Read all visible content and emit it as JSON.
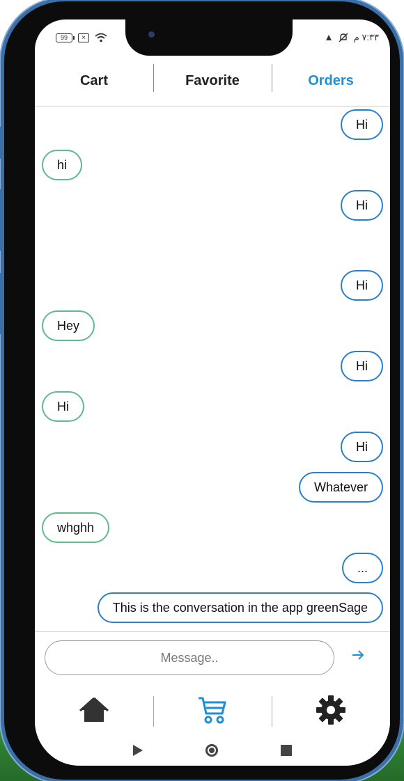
{
  "status_bar": {
    "battery": "99",
    "time": "٧:٣٣ م"
  },
  "tabs": [
    {
      "label": "Cart",
      "active": false
    },
    {
      "label": "Favorite",
      "active": false
    },
    {
      "label": "Orders",
      "active": true
    }
  ],
  "messages": [
    {
      "text": "Hi",
      "from": "me"
    },
    {
      "text": "hi",
      "from": "other"
    },
    {
      "text": "Hi",
      "from": "me"
    },
    {
      "text": "Hi",
      "from": "me"
    },
    {
      "text": "Hey",
      "from": "other"
    },
    {
      "text": "Hi",
      "from": "me"
    },
    {
      "text": "Hi",
      "from": "other"
    },
    {
      "text": "Hi",
      "from": "me"
    },
    {
      "text": "Whatever",
      "from": "me"
    },
    {
      "text": "whghh",
      "from": "other"
    },
    {
      "text": "...",
      "from": "me"
    },
    {
      "text": "This is the conversation in the app greenSage",
      "from": "me"
    }
  ],
  "composer": {
    "placeholder": "Message..",
    "send_icon": "arrow-right-icon"
  },
  "bottom_nav": [
    {
      "icon": "home-icon",
      "active": false
    },
    {
      "icon": "cart-icon",
      "active": true
    },
    {
      "icon": "gear-icon",
      "active": false
    }
  ],
  "colors": {
    "accent": "#1e8fd6",
    "my_bubble_border": "#2c7fc7",
    "other_bubble_border": "#5fba8c",
    "icon_dark": "#333333"
  }
}
